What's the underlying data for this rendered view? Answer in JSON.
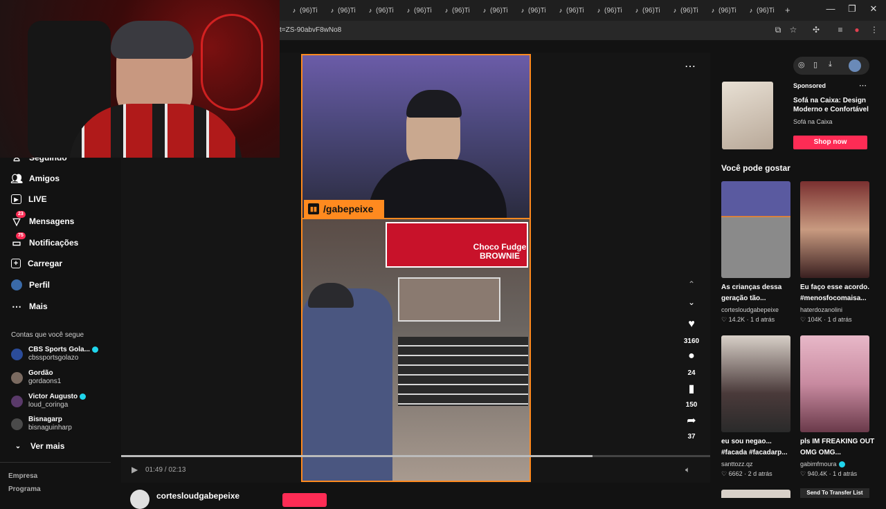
{
  "browser": {
    "tabs": [
      {
        "label": "(96)Ti"
      },
      {
        "label": "(96)Ti"
      },
      {
        "label": "(96)Ti"
      },
      {
        "label": "(96)Ti"
      },
      {
        "label": "(96)Ti"
      },
      {
        "label": "(96)Ti"
      },
      {
        "label": "(96)Ti"
      },
      {
        "label": "(96)Ti"
      },
      {
        "label": "(96)Ti"
      },
      {
        "label": "(96)Ti"
      },
      {
        "label": "(96)Ti"
      },
      {
        "label": "(96)Ti"
      },
      {
        "label": "(96)Ti"
      }
    ],
    "new_tab": "+",
    "url": "t=ZS-90abvF8wNo8",
    "controls": {
      "minimize": "—",
      "restore": "❐",
      "close": "✕"
    }
  },
  "sidebar": {
    "partial_item": "Seguindo",
    "items": [
      {
        "label": "Amigos",
        "icon": "friends-icon"
      },
      {
        "label": "LIVE",
        "icon": "live-icon"
      },
      {
        "label": "Mensagens",
        "icon": "messages-icon",
        "badge": "23"
      },
      {
        "label": "Notificações",
        "icon": "notifications-icon",
        "badge": "75"
      },
      {
        "label": "Carregar",
        "icon": "upload-icon"
      },
      {
        "label": "Perfil",
        "icon": "profile-icon"
      },
      {
        "label": "Mais",
        "icon": "more-icon"
      }
    ],
    "following_header": "Contas que você segue",
    "following": [
      {
        "name": "CBS Sports Gola...",
        "handle": "cbssportsgolazo",
        "verified": true
      },
      {
        "name": "Gordão",
        "handle": "gordaons1",
        "verified": false
      },
      {
        "name": "Victor Augusto",
        "handle": "loud_coringa",
        "verified": true
      },
      {
        "name": "Bisnagarp",
        "handle": "bisnaguinharp",
        "verified": false
      }
    ],
    "see_more": "Ver mais",
    "footer": [
      "Empresa",
      "Programa"
    ]
  },
  "video": {
    "twitch_handle": "/gabepeixe",
    "menu_text": "Choco Fudge BROWNIE",
    "time": "01:49 / 02:13",
    "progress": 0.8,
    "author": "cortesloudgabepeixe",
    "actions": [
      {
        "icon": "heart-icon",
        "count": "3160"
      },
      {
        "icon": "comment-icon",
        "count": "24"
      },
      {
        "icon": "bookmark-icon",
        "count": "150"
      },
      {
        "icon": "share-icon",
        "count": "37"
      }
    ]
  },
  "ad": {
    "sponsored": "Sponsored",
    "title": "Sofá na Caixa: Design Moderno e Confortável",
    "advertiser": "Sofá na Caixa",
    "cta": "Shop now"
  },
  "recommendations": {
    "header": "Você pode gostar",
    "items": [
      {
        "title": "As crianças dessa geração tão...",
        "user": "cortesloudgabepeixe",
        "likes": "14.2K",
        "age": "1 d atrás"
      },
      {
        "title": "Eu faço esse acordo. #menosfocomaisa...",
        "user": "haterdozanolini",
        "likes": "104K",
        "age": "1 d atrás"
      },
      {
        "title": "eu sou negao... #facada #facadarp...",
        "user": "santtozz.qz",
        "likes": "6662",
        "age": "2 d atrás"
      },
      {
        "title": "pls IM FREAKING OUT OMG OMG...",
        "user": "gabimfmoura",
        "likes": "940.4K",
        "age": "1 d atrás"
      }
    ],
    "bottom_label": "Send To Transfer List"
  },
  "colors": {
    "accent": "#fe2c55",
    "frame": "#ff8a1f",
    "verified": "#20d5ec"
  }
}
